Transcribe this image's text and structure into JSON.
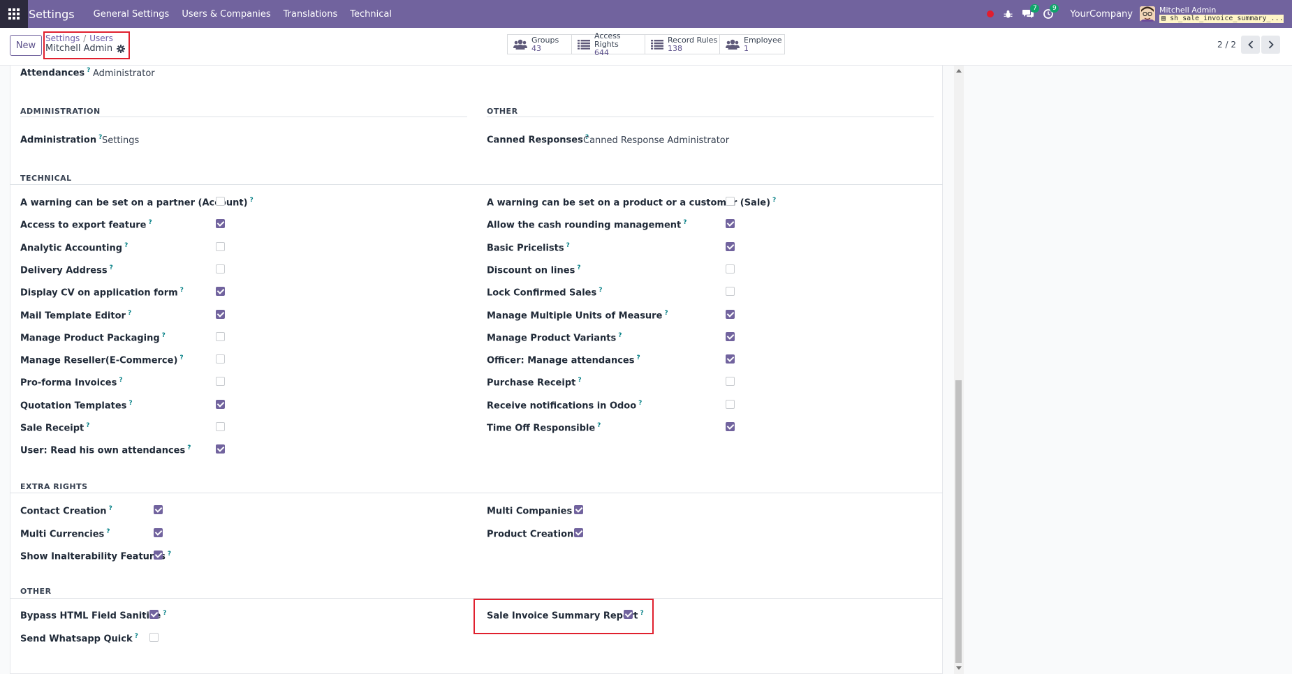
{
  "navbar": {
    "brand": "Settings",
    "menu": [
      "General Settings",
      "Users & Companies",
      "Translations",
      "Technical"
    ],
    "chat_count": "7",
    "activity_count": "9",
    "company": "YourCompany",
    "user_name": "Mitchell Admin",
    "db_name": "sh_sale_invoice_summary_..."
  },
  "control": {
    "new_label": "New",
    "breadcrumb_root": "Settings",
    "breadcrumb_sep": "/",
    "breadcrumb_current": "Users",
    "record_title": "Mitchell Admin",
    "pager": "2 / 2",
    "smart_buttons": [
      {
        "label": "Groups",
        "value": "43",
        "icon": "users-icon"
      },
      {
        "label": "Access Rights",
        "value": "644",
        "icon": "list-icon"
      },
      {
        "label": "Record Rules",
        "value": "138",
        "icon": "list-icon"
      },
      {
        "label": "Employee",
        "value": "1",
        "icon": "users-icon"
      }
    ]
  },
  "form": {
    "top_row": {
      "label": "Attendances",
      "value": "Administrator"
    },
    "admin_section": "ADMINISTRATION",
    "admin_row": {
      "label": "Administration",
      "value": "Settings"
    },
    "other_top_section": "OTHER",
    "canned_row": {
      "label": "Canned Responses",
      "value": "Canned Response Administrator"
    },
    "technical_section": "TECHNICAL",
    "technical_left": [
      {
        "label": "A warning can be set on a partner (Account)",
        "checked": false
      },
      {
        "label": "Access to export feature",
        "checked": true
      },
      {
        "label": "Analytic Accounting",
        "checked": false
      },
      {
        "label": "Delivery Address",
        "checked": false
      },
      {
        "label": "Display CV on application form",
        "checked": true
      },
      {
        "label": "Mail Template Editor",
        "checked": true
      },
      {
        "label": "Manage Product Packaging",
        "checked": false
      },
      {
        "label": "Manage Reseller(E-Commerce)",
        "checked": false
      },
      {
        "label": "Pro-forma Invoices",
        "checked": false
      },
      {
        "label": "Quotation Templates",
        "checked": true
      },
      {
        "label": "Sale Receipt",
        "checked": false
      },
      {
        "label": "User: Read his own attendances",
        "checked": true
      }
    ],
    "technical_right": [
      {
        "label": "A warning can be set on a product or a customer (Sale)",
        "checked": false
      },
      {
        "label": "Allow the cash rounding management",
        "checked": true
      },
      {
        "label": "Basic Pricelists",
        "checked": true
      },
      {
        "label": "Discount on lines",
        "checked": false
      },
      {
        "label": "Lock Confirmed Sales",
        "checked": false
      },
      {
        "label": "Manage Multiple Units of Measure",
        "checked": true
      },
      {
        "label": "Manage Product Variants",
        "checked": true
      },
      {
        "label": "Officer: Manage attendances",
        "checked": true
      },
      {
        "label": "Purchase Receipt",
        "checked": false
      },
      {
        "label": "Receive notifications in Odoo",
        "checked": false
      },
      {
        "label": "Time Off Responsible",
        "checked": true
      }
    ],
    "extra_section": "EXTRA RIGHTS",
    "extra_left": [
      {
        "label": "Contact Creation",
        "checked": true
      },
      {
        "label": "Multi Currencies",
        "checked": true
      },
      {
        "label": "Show Inalterability Features",
        "checked": true
      }
    ],
    "extra_right": [
      {
        "label": "Multi Companies",
        "checked": true
      },
      {
        "label": "Product Creation",
        "checked": true
      }
    ],
    "other_section": "OTHER",
    "other_left": [
      {
        "label": "Bypass HTML Field Sanitize",
        "checked": true
      },
      {
        "label": "Send Whatsapp Quick",
        "checked": false
      }
    ],
    "other_right": [
      {
        "label": "Sale Invoice Summary Report",
        "checked": true
      }
    ],
    "help_mark": "?"
  }
}
